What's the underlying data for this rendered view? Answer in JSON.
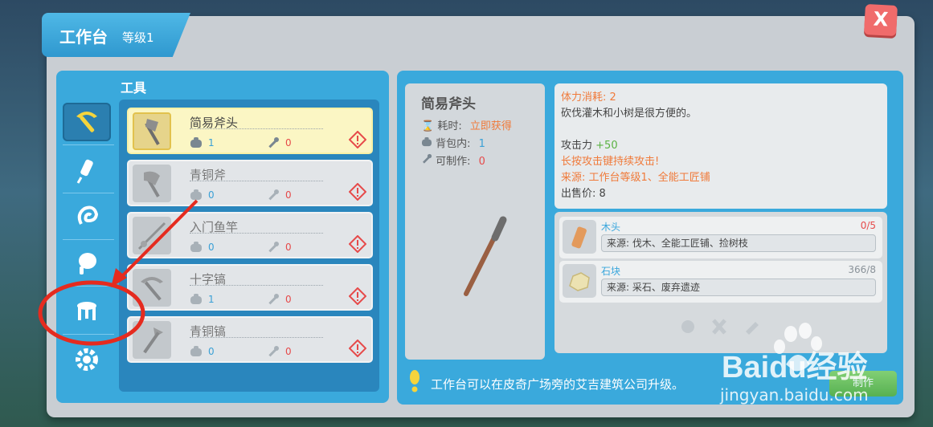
{
  "window": {
    "title": "工作台",
    "level": "等级1",
    "close_label": "X"
  },
  "section": {
    "title": "工具"
  },
  "categories": [
    {
      "icon": "pickaxe-icon",
      "selected": true
    },
    {
      "icon": "syringe-icon",
      "selected": false
    },
    {
      "icon": "ear-icon",
      "selected": false
    },
    {
      "icon": "meat-icon",
      "selected": false
    },
    {
      "icon": "stool-icon",
      "selected": false
    },
    {
      "icon": "gear-icon",
      "selected": false
    }
  ],
  "items": [
    {
      "name": "简易斧头",
      "bag": "1",
      "craftable": "0",
      "selected": true
    },
    {
      "name": "青铜斧",
      "bag": "0",
      "craftable": "0",
      "selected": false
    },
    {
      "name": "入门鱼竿",
      "bag": "0",
      "craftable": "0",
      "selected": false
    },
    {
      "name": "十字镐",
      "bag": "1",
      "craftable": "0",
      "selected": false
    },
    {
      "name": "青铜镐",
      "bag": "0",
      "craftable": "0",
      "selected": false
    }
  ],
  "detail": {
    "name": "简易斧头",
    "time_label": "耗时:",
    "time_value": "立即获得",
    "bag_label": "背包内:",
    "bag_value": "1",
    "craft_label": "可制作:",
    "craft_value": "0",
    "stamina": "体力消耗: 2",
    "desc": "砍伐灌木和小树是很方便的。",
    "attack_label": "攻击力",
    "attack_value": "+50",
    "hold": "长按攻击键持续攻击!",
    "source": "来源: 工作台等级1、全能工匠铺",
    "price": "出售价: 8"
  },
  "materials": [
    {
      "name": "木头",
      "count": "0/5",
      "source": "来源: 伐木、全能工匠铺、捡树枝",
      "count_color": "#e64a4a",
      "icon": "wood-icon"
    },
    {
      "name": "石块",
      "count": "366/8",
      "source": "来源: 采石、废弃遗迹",
      "count_color": "#8a9299",
      "icon": "stone-icon"
    }
  ],
  "tip": "工作台可以在皮奇广场旁的艾吉建筑公司升级。",
  "craft_button": "制作",
  "watermark": {
    "brand": "Baidu经验",
    "url": "jingyan.baidu.com"
  },
  "colors": {
    "accent_blue": "#3aa9dc",
    "warn_red": "#e64a4a",
    "info_blue": "#3aa0d6",
    "orange": "#f07a3a",
    "green": "#5bb243"
  }
}
